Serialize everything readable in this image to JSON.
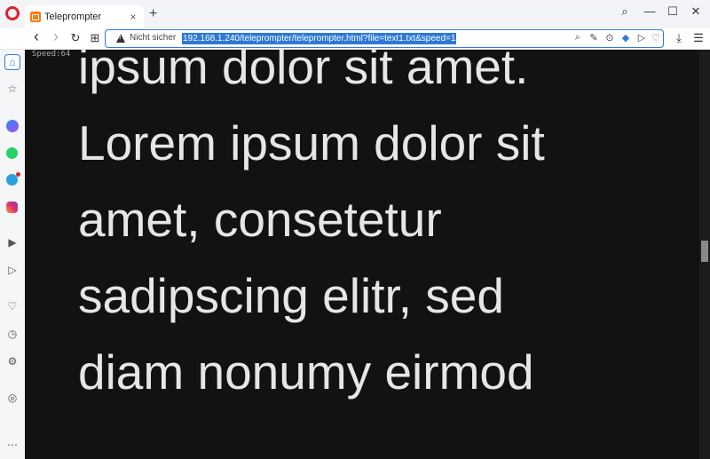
{
  "browser": {
    "tab_title": "Teleprompter",
    "tab_close": "×",
    "new_tab": "+",
    "security_label": "Nicht sicher",
    "url": "192.168.1.240/teleprompter/teleprompter.html?file=text1.txt&speed=1"
  },
  "icons": {
    "search": "⌕",
    "minimize": "—",
    "maximize": "☐",
    "close": "✕",
    "back": "‹",
    "forward": "›",
    "reload": "↻",
    "tabs": "⊞",
    "zoom": "⌕",
    "edit": "✎",
    "camera": "⊙",
    "shield": "◆",
    "send": "▷",
    "heart": "♡",
    "download": "⤓",
    "settings": "☰",
    "home": "⌂",
    "pin": "☆",
    "player": "▶",
    "flow": "▷",
    "favorites": "♡",
    "history": "◷",
    "gear": "⚙",
    "tips": "◎",
    "more": "⋯"
  },
  "teleprompter": {
    "speed_label": "Speed:64",
    "lines": [
      "ipsum dolor sit amet.",
      "Lorem ipsum dolor sit",
      "amet, consetetur",
      "sadipscing elitr, sed",
      "diam nonumy eirmod"
    ]
  },
  "colors": {
    "accent": "#2e7ad6",
    "prompter_bg": "#121212",
    "prompter_text": "#e6e6e6"
  }
}
